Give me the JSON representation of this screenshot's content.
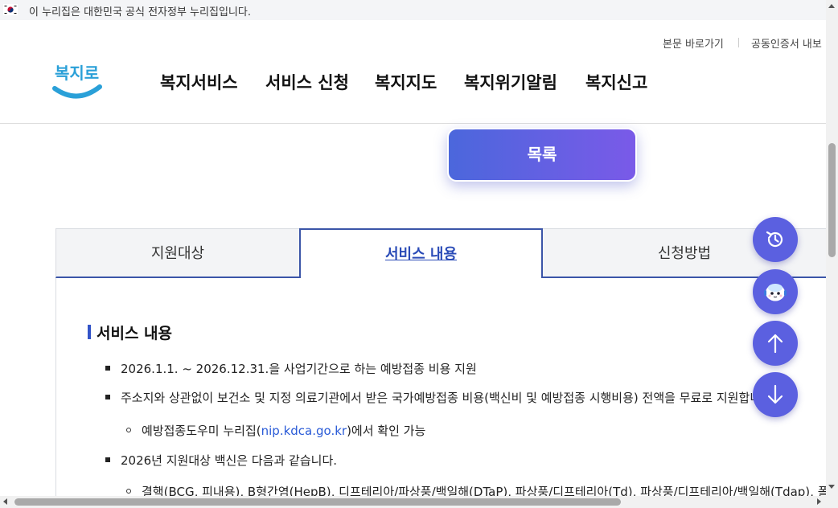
{
  "gov_banner": {
    "text": "이 누리집은 대한민국 공식 전자정부 누리집입니다."
  },
  "utility_links": [
    "본문 바로가기",
    "공동인증서 내보"
  ],
  "logo_text": "복지로",
  "gnb": [
    "복지서비스",
    "서비스 신청",
    "복지지도",
    "복지위기알림",
    "복지신고"
  ],
  "list_button": "목록",
  "tabs": [
    "지원대상",
    "서비스 내용",
    "신청방법"
  ],
  "content": {
    "section_title": "서비스 내용",
    "item1": "2026.1.1. ~ 2026.12.31.을 사업기간으로 하는 예방접종 비용 지원",
    "item2": "주소지와 상관없이 보건소 및 지정 의료기관에서 받은 국가예방접종 비용(백신비 및 예방접종 시행비용) 전액을 무료로 지원합니다",
    "sub1_prefix": "예방접종도우미 누리집(",
    "sub1_link": "nip.kdca.go.kr",
    "sub1_suffix": ")에서 확인 가능",
    "item3": "2026년 지원대상 백신은 다음과 같습니다.",
    "sub2": "결핵(BCG, 피내용), B형간염(HepB), 디프테리아/파상풍/백일해(DTaP), 파상풍/디프테리아(Td), 파상풍/디프테리아/백일해(Tdap), 폴리오"
  },
  "fab_buttons": [
    "history-icon",
    "chatbot-icon",
    "arrow-up-icon",
    "arrow-down-icon"
  ],
  "colors": {
    "accent": "#3b55a8",
    "button_gradient_start": "#4b67dc",
    "button_gradient_end": "#7a5ae8",
    "fab": "#5b60e0"
  }
}
